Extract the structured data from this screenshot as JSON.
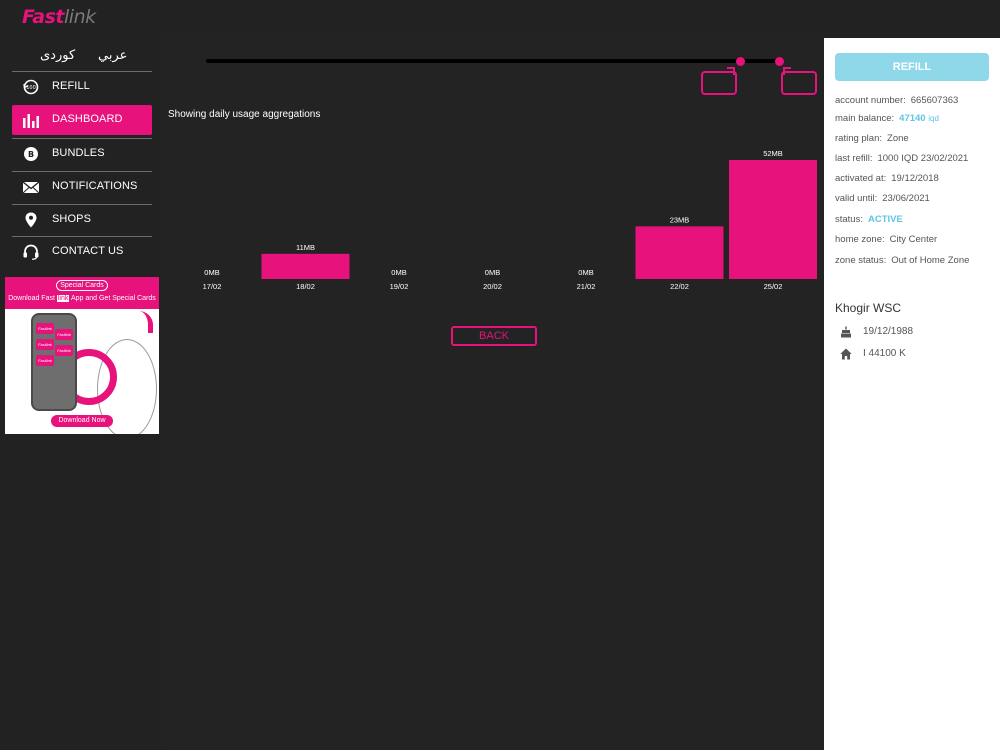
{
  "brand": {
    "logo_main": "Fast",
    "logo_tail": "link",
    "accent": "#e8127c"
  },
  "sidebar": {
    "languages": [
      "کوردی",
      "عربي"
    ],
    "items": [
      {
        "label": "REFILL",
        "icon": "refill-icon",
        "active": false
      },
      {
        "label": "DASHBOARD",
        "icon": "bar-chart-icon",
        "active": true
      },
      {
        "label": "BUNDLES",
        "icon": "bundle-icon",
        "active": false
      },
      {
        "label": "NOTIFICATIONS",
        "icon": "envelope-icon",
        "active": false
      },
      {
        "label": "SHOPS",
        "icon": "location-pin-icon",
        "active": false
      },
      {
        "label": "CONTACT US",
        "icon": "headset-icon",
        "active": false
      }
    ]
  },
  "promo": {
    "badge": "Special Cards",
    "line_start": "Download Fast",
    "line_highlight": "link",
    "line_end": "App and Get Special Cards",
    "tile_label": "Fastlink",
    "button": "Download Now"
  },
  "main": {
    "caption": "Showing daily usage aggregations",
    "back_label": "BACK"
  },
  "chart_data": {
    "type": "bar",
    "categories": [
      "17/02",
      "18/02",
      "19/02",
      "20/02",
      "21/02",
      "22/02",
      "25/02"
    ],
    "values": [
      0,
      11,
      0,
      0,
      0,
      23,
      52
    ],
    "value_labels": [
      "0MB",
      "11MB",
      "0MB",
      "0MB",
      "0MB",
      "23MB",
      "52MB"
    ],
    "ylim": [
      0,
      52
    ],
    "color": "#e8127c",
    "grid": false,
    "legend": false
  },
  "account": {
    "refill_label": "REFILL",
    "rows": [
      {
        "key": "account number:",
        "value": "665607363"
      },
      {
        "key": "main balance:",
        "value": "47140",
        "unit": "iqd",
        "highlight": true
      },
      {
        "key": "rating plan:",
        "value": "Zone"
      },
      {
        "key": "last refill:",
        "value": "1000 IQD  23/02/2021"
      },
      {
        "key": "activated at:",
        "value": "19/12/2018"
      },
      {
        "key": "valid until:",
        "value": "23/06/2021"
      },
      {
        "key": "status:",
        "value": "ACTIVE",
        "highlight": true
      },
      {
        "key": "home zone:",
        "value": "City Center"
      },
      {
        "key": "zone status:",
        "value": "Out of Home Zone"
      }
    ],
    "highlight_color": "#5cc6e4"
  },
  "user": {
    "name": "Khogir WSC",
    "birthday": "19/12/1988",
    "address": "I 44100 K"
  }
}
